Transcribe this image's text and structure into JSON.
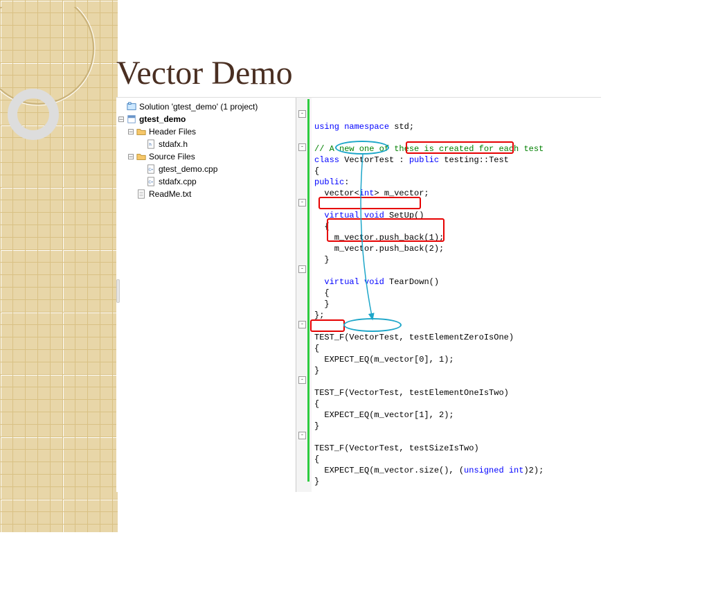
{
  "title": "Vector Demo",
  "solution": {
    "line": "Solution 'gtest_demo' (1 project)",
    "project": "gtest_demo",
    "folders": {
      "header": "Header Files",
      "source": "Source Files"
    },
    "files": {
      "stdafx_h": "stdafx.h",
      "gtest_cpp": "gtest_demo.cpp",
      "stdafx_cpp": "stdafx.cpp",
      "readme": "ReadMe.txt"
    }
  },
  "code": {
    "using_ns": "using namespace",
    "std": " std;",
    "comment": "// A new one of these is created for each test",
    "class_kw": "class",
    "vectortest": " VectorTest : ",
    "public_kw": "public",
    "testing_test": " testing::Test",
    "brace_o": "{",
    "public_label": "public",
    "public_colon": ":",
    "vector_decl_1": "  vector<",
    "int_kw": "int",
    "vector_decl_2": "> m_vector;",
    "virtual_void": "virtual void",
    "setup": " SetUp()",
    "brace_o2": "  {",
    "push1": "    m_vector.push_back(1);",
    "push2": "    m_vector.push_back(2);",
    "brace_c2": "  }",
    "teardown": " TearDown()",
    "brace_o3": "  {",
    "brace_c3": "  }",
    "class_end": "};",
    "test1_sig": "TEST_F(VectorTest, testElementZeroIsOne)",
    "test1_body": "  EXPECT_EQ(m_vector[0], 1);",
    "test2_sig": "TEST_F(VectorTest, testElementOneIsTwo)",
    "test2_body": "  EXPECT_EQ(m_vector[1], 2);",
    "test3_sig": "TEST_F(VectorTest, testSizeIsTwo)",
    "test3_body_1": "  EXPECT_EQ(m_vector.size(), (",
    "uint_kw": "unsigned int",
    "test3_body_2": ")2);",
    "brace_c": "}"
  }
}
